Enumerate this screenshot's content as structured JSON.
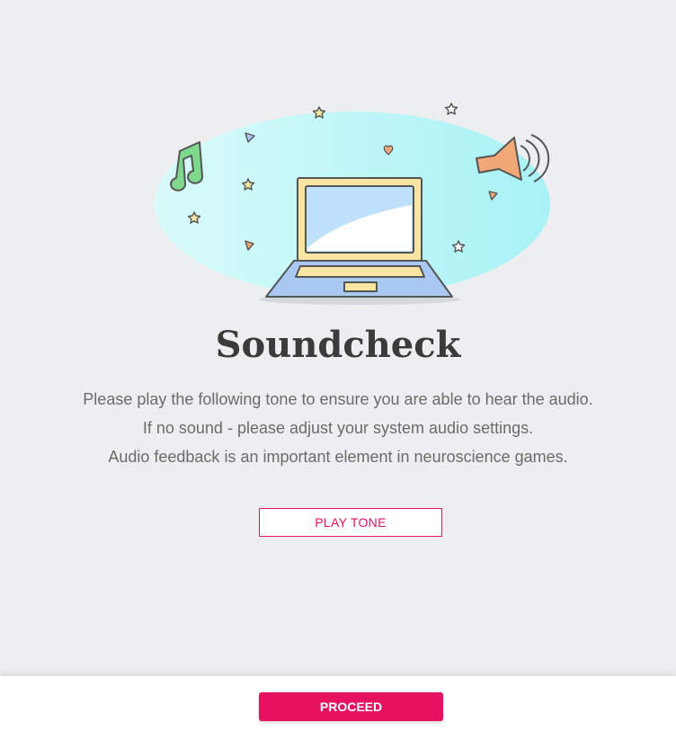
{
  "soundcheck": {
    "title": "Soundcheck",
    "instructions": [
      "Please play the following tone to ensure you are able to hear the audio.",
      "If no sound - please adjust your system audio settings.",
      "Audio feedback is an important element in neuroscience games."
    ],
    "play_tone_label": "PLAY TONE"
  },
  "footer": {
    "proceed_label": "PROCEED"
  },
  "colors": {
    "accent": "#e6125f",
    "background": "#eceef0",
    "blob": "#b3f3f6",
    "laptop_frame": "#f7e5a4",
    "laptop_base": "#a9c9f2",
    "screen": "#bfe1fb",
    "music_note": "#7fd98c",
    "speaker": "#f2a877"
  },
  "icons": [
    "laptop-icon",
    "music-note-icon",
    "speaker-icon",
    "star-icon",
    "heart-icon",
    "triangle-icon"
  ]
}
